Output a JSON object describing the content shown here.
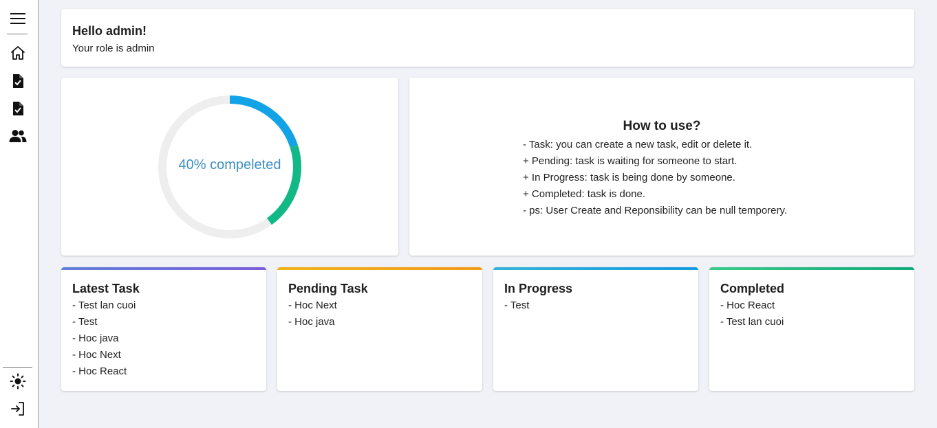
{
  "sidebar": {
    "top_icons": [
      {
        "name": "menu-icon"
      },
      {
        "name": "home-icon"
      },
      {
        "name": "task-document-icon"
      },
      {
        "name": "pending-document-icon"
      },
      {
        "name": "users-icon"
      }
    ],
    "bottom_icons": [
      {
        "name": "sun-icon"
      },
      {
        "name": "logout-icon"
      }
    ]
  },
  "greeting": {
    "title": "Hello admin!",
    "subtitle": "Your role is admin"
  },
  "progress": {
    "label": "40% compeleted",
    "completed_fraction": 0.4,
    "segments": [
      {
        "fraction": 0.2,
        "color": "#12a3e6"
      },
      {
        "fraction": 0.2,
        "color": "#12b886"
      }
    ],
    "track_color": "#eeeeee"
  },
  "howto": {
    "title": "How to use?",
    "lines": [
      "- Task: you can create a new task, edit or delete it.",
      "+ Pending: task is waiting for someone to start.",
      "+ In Progress: task is being done by someone.",
      "+ Completed: task is done.",
      "- ps: User Create and Reponsibility can be null temporery."
    ]
  },
  "task_cards": [
    {
      "title": "Latest Task",
      "accent": [
        "#5f7fd8",
        "#7a5fd8"
      ],
      "items": [
        "- Test lan cuoi",
        "- Test",
        "- Hoc java",
        "- Hoc Next",
        "- Hoc React"
      ]
    },
    {
      "title": "Pending Task",
      "accent": [
        "#f2b21a",
        "#f29a1a"
      ],
      "items": [
        "- Hoc Next",
        "- Hoc java"
      ]
    },
    {
      "title": "In Progress",
      "accent": [
        "#36b3d9",
        "#1499e0"
      ],
      "items": [
        "- Test"
      ]
    },
    {
      "title": "Completed",
      "accent": [
        "#3cc98a",
        "#12a97a"
      ],
      "items": [
        "- Hoc React",
        "- Test lan cuoi"
      ]
    }
  ]
}
